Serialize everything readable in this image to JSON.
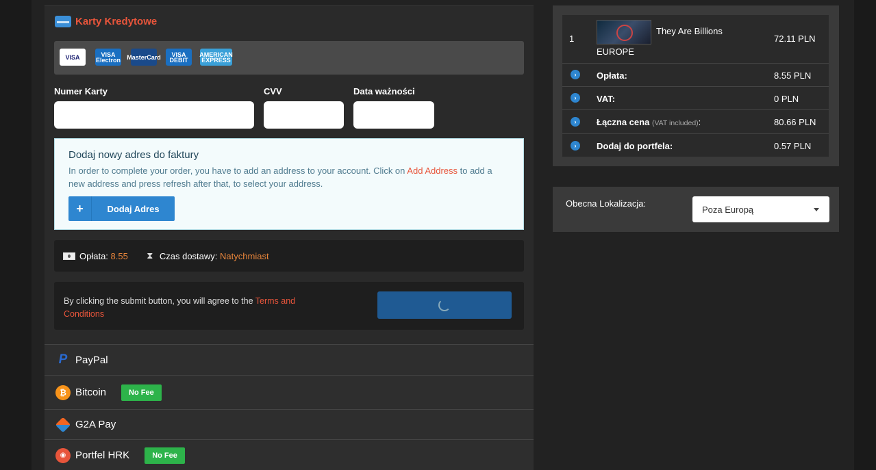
{
  "payment": {
    "credit_cards_title": "Karty Kredytowe",
    "card_logos": [
      {
        "name": "visa",
        "text": "VISA",
        "bg": "#ffffff",
        "fg": "#1a1f71"
      },
      {
        "name": "visa-electron",
        "text": "VISA Electron",
        "bg": "#1a6fc1",
        "fg": "#ffffff"
      },
      {
        "name": "mastercard",
        "text": "MasterCard",
        "bg": "#1a4a8a",
        "fg": "#ffffff"
      },
      {
        "name": "visa-debit",
        "text": "VISA DEBIT",
        "bg": "#1a6fc1",
        "fg": "#ffffff"
      },
      {
        "name": "american-express",
        "text": "AMERICAN EXPRESS",
        "bg": "#3aa0d8",
        "fg": "#ffffff"
      }
    ],
    "card_number_label": "Numer Karty",
    "cvv_label": "CVV",
    "expiry_label": "Data ważności",
    "card_number_value": "",
    "cvv_value": "",
    "expiry_value": ""
  },
  "address": {
    "title": "Dodaj nowy adres do faktury",
    "text_before": "In order to complete your order, you have to add an address to your account. Click on ",
    "link_text": "Add Address",
    "text_after": " to add a new address and press refresh after that, to select your address.",
    "button_label": "Dodaj Adres"
  },
  "fee_bar": {
    "fee_label": "Opłata:",
    "fee_value": "8.55",
    "delivery_label": "Czas dostawy:",
    "delivery_value": "Natychmiast"
  },
  "submit": {
    "text_before": "By clicking the submit button, you will agree to the ",
    "terms_link": "Terms and Conditions"
  },
  "payment_methods": [
    {
      "name": "PayPal",
      "no_fee": false,
      "no_fee_label": ""
    },
    {
      "name": "Bitcoin",
      "no_fee": true,
      "no_fee_label": "No Fee"
    },
    {
      "name": "G2A Pay",
      "no_fee": false,
      "no_fee_label": ""
    },
    {
      "name": "Portfel HRK",
      "no_fee": true,
      "no_fee_label": "No Fee"
    }
  ],
  "summary": {
    "item": {
      "qty": "1",
      "title": "They Are Billions",
      "region": "EUROPE",
      "price": "72.11 PLN"
    },
    "rows": [
      {
        "label": "Opłata:",
        "note": "",
        "value": "8.55 PLN"
      },
      {
        "label": "VAT:",
        "note": "",
        "value": "0 PLN"
      },
      {
        "label": "Łączna cena",
        "note": "(VAT included)",
        "suffix": ":",
        "value": "80.66 PLN"
      },
      {
        "label": "Dodaj do portfela:",
        "note": "",
        "value": "0.57 PLN"
      }
    ]
  },
  "location": {
    "label": "Obecna Lokalizacja:",
    "selected": "Poza Europą"
  },
  "colors": {
    "accent_orange": "#e8553b",
    "accent_blue": "#2e86d0",
    "no_fee_green": "#2db34a"
  }
}
